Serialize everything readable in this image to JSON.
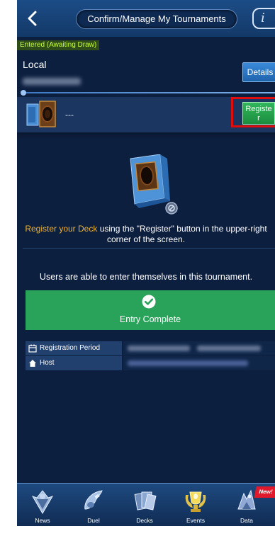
{
  "header": {
    "title": "Confirm/Manage My Tournaments",
    "info_label": "i"
  },
  "tournament": {
    "status": "Entered (Awaiting Draw)",
    "name": "Local",
    "details_label": "Details"
  },
  "deck": {
    "name": "---",
    "register_label": "Registe r"
  },
  "hint": {
    "accent": "Register your Deck",
    "line1_rest": " using the \"Register\" button in the upper-right",
    "line2": "corner of the screen."
  },
  "entry": {
    "message": "Users are able to enter themselves in this tournament.",
    "button_label": "Entry Complete"
  },
  "info": {
    "registration_label": "Registration Period",
    "host_label": "Host"
  },
  "nav": {
    "items": [
      {
        "label": "News"
      },
      {
        "label": "Duel"
      },
      {
        "label": "Decks"
      },
      {
        "label": "Events"
      },
      {
        "label": "Data"
      }
    ],
    "badge": "New!"
  },
  "colors": {
    "background": "#0d1f3f",
    "accent_orange": "#f0b12d",
    "entry_green": "#2aa35a",
    "status_text": "#c6ff3a",
    "highlight_red": "#e10d0d"
  }
}
